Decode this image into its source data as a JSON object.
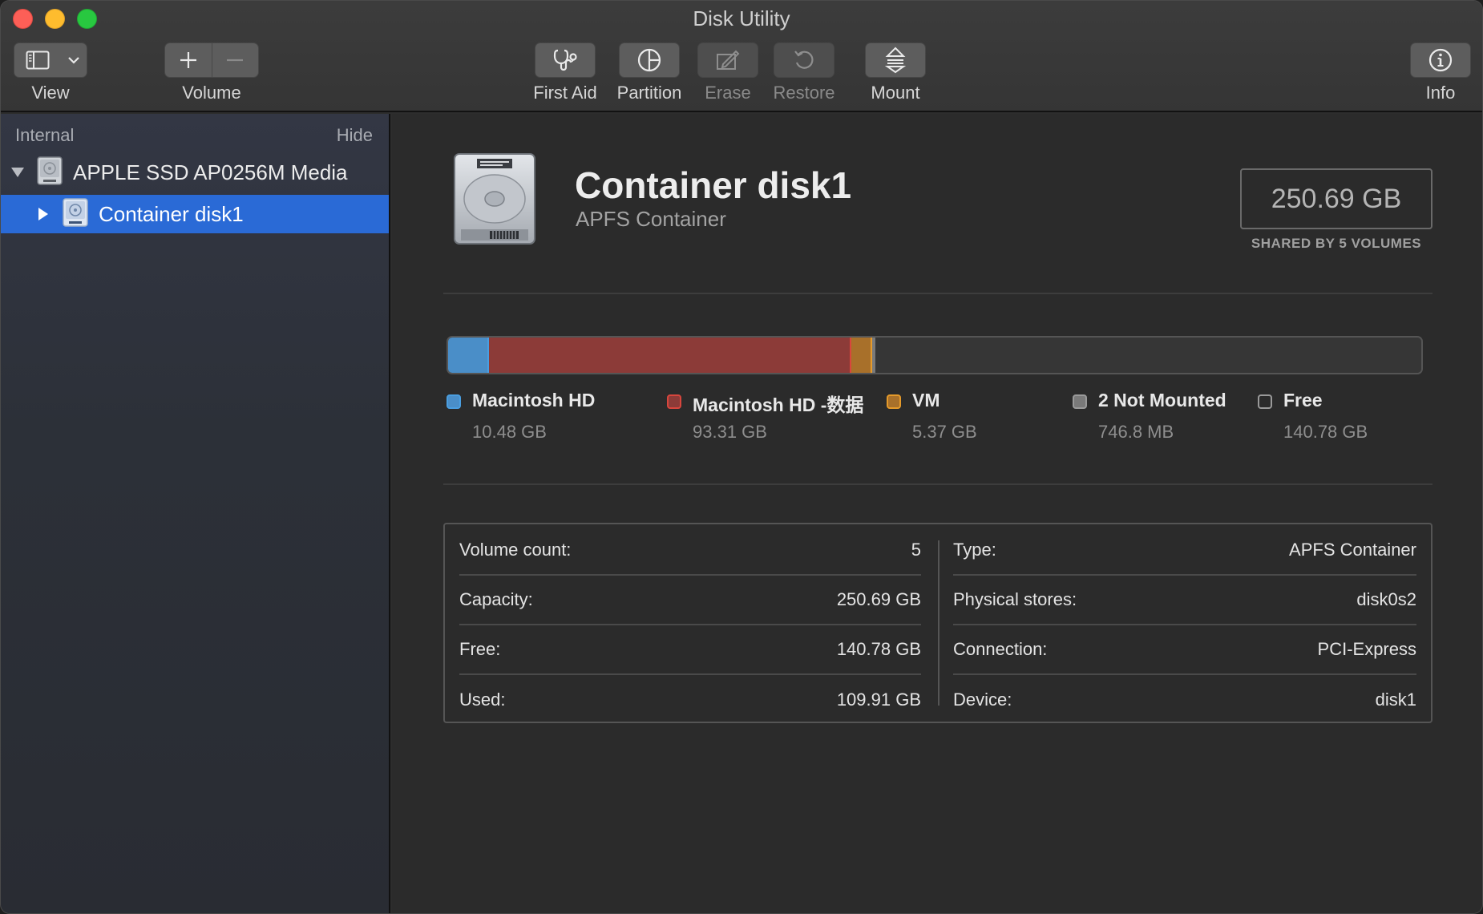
{
  "window": {
    "title": "Disk Utility"
  },
  "toolbar": {
    "view_label": "View",
    "volume_label": "Volume",
    "first_aid_label": "First Aid",
    "partition_label": "Partition",
    "erase_label": "Erase",
    "restore_label": "Restore",
    "mount_label": "Mount",
    "info_label": "Info",
    "icons": [
      "sidebar-icon",
      "chevron-down-icon",
      "plus-icon",
      "minus-icon",
      "stethoscope-icon",
      "pie-icon",
      "erase-icon",
      "restore-icon",
      "mount-icon",
      "info-icon"
    ]
  },
  "sidebar": {
    "section": "Internal",
    "hide_label": "Hide",
    "items": [
      {
        "label": "APPLE SSD AP0256M Media",
        "expanded": true,
        "selected": false
      },
      {
        "label": "Container disk1",
        "expanded": false,
        "selected": true
      }
    ]
  },
  "detail": {
    "title": "Container disk1",
    "subtitle": "APFS Container",
    "size": "250.69 GB",
    "size_caption": "SHARED BY 5 VOLUMES",
    "usage": [
      {
        "name": "Macintosh HD",
        "size": "10.48 GB",
        "fraction": 0.0418,
        "color": "#4a8ec8",
        "border": "#4a9ee0"
      },
      {
        "name": "Macintosh HD -数据",
        "size": "93.31 GB",
        "fraction": 0.3722,
        "color": "#8c3b38",
        "border": "#d8463d"
      },
      {
        "name": "VM",
        "size": "5.37 GB",
        "fraction": 0.0214,
        "color": "#a8702a",
        "border": "#e59a2a"
      },
      {
        "name": "2 Not Mounted",
        "size": "746.8 MB",
        "fraction": 0.003,
        "color": "#7a7a7a",
        "border": "#9a9a9a"
      },
      {
        "name": "Free",
        "size": "140.78 GB",
        "fraction": 0.5616,
        "color": "#363636",
        "border": "#9a9a9a"
      }
    ],
    "info_left": [
      {
        "key": "Volume count:",
        "value": "5"
      },
      {
        "key": "Capacity:",
        "value": "250.69 GB"
      },
      {
        "key": "Free:",
        "value": "140.78 GB"
      },
      {
        "key": "Used:",
        "value": "109.91 GB"
      }
    ],
    "info_right": [
      {
        "key": "Type:",
        "value": "APFS Container"
      },
      {
        "key": "Physical stores:",
        "value": "disk0s2"
      },
      {
        "key": "Connection:",
        "value": "PCI-Express"
      },
      {
        "key": "Device:",
        "value": "disk1"
      }
    ]
  }
}
